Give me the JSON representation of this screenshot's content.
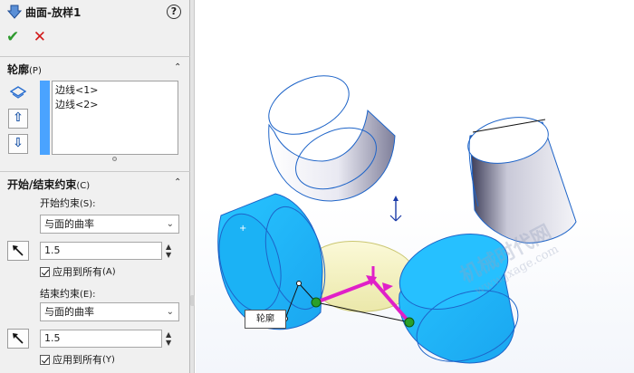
{
  "feature": {
    "title": "曲面-放样1",
    "help_glyph": "?",
    "ok_glyph": "✔",
    "cancel_glyph": "✕"
  },
  "profiles": {
    "title": "轮廓",
    "suffix": "(P)",
    "items": [
      "边线<1>",
      "边线<2>"
    ],
    "up_glyph": "⇧",
    "down_glyph": "⇩"
  },
  "constraints": {
    "title": "开始/结束约束",
    "suffix": "(C)",
    "start_label": "开始约束",
    "start_suffix": "(S):",
    "start_type": "与面的曲率",
    "start_value": "1.5",
    "start_apply_label": "应用到所有",
    "start_apply_suffix": "(A)",
    "start_apply_checked": true,
    "end_label": "结束约束",
    "end_suffix": "(E):",
    "end_type": "与面的曲率",
    "end_value": "1.5",
    "end_apply_label": "应用到所有",
    "end_apply_suffix": "(Y)",
    "end_apply_checked": true
  },
  "viewport": {
    "callout_label": "轮廓",
    "watermark_cn": "机械时代网",
    "watermark_en": "www.jxage.com"
  },
  "colors": {
    "selected_face": "#22c0ff",
    "preview_surface": "#f4f2b8",
    "connector": "#e020c8",
    "handle": "#2aa02a",
    "edge": "#1e64c8"
  }
}
